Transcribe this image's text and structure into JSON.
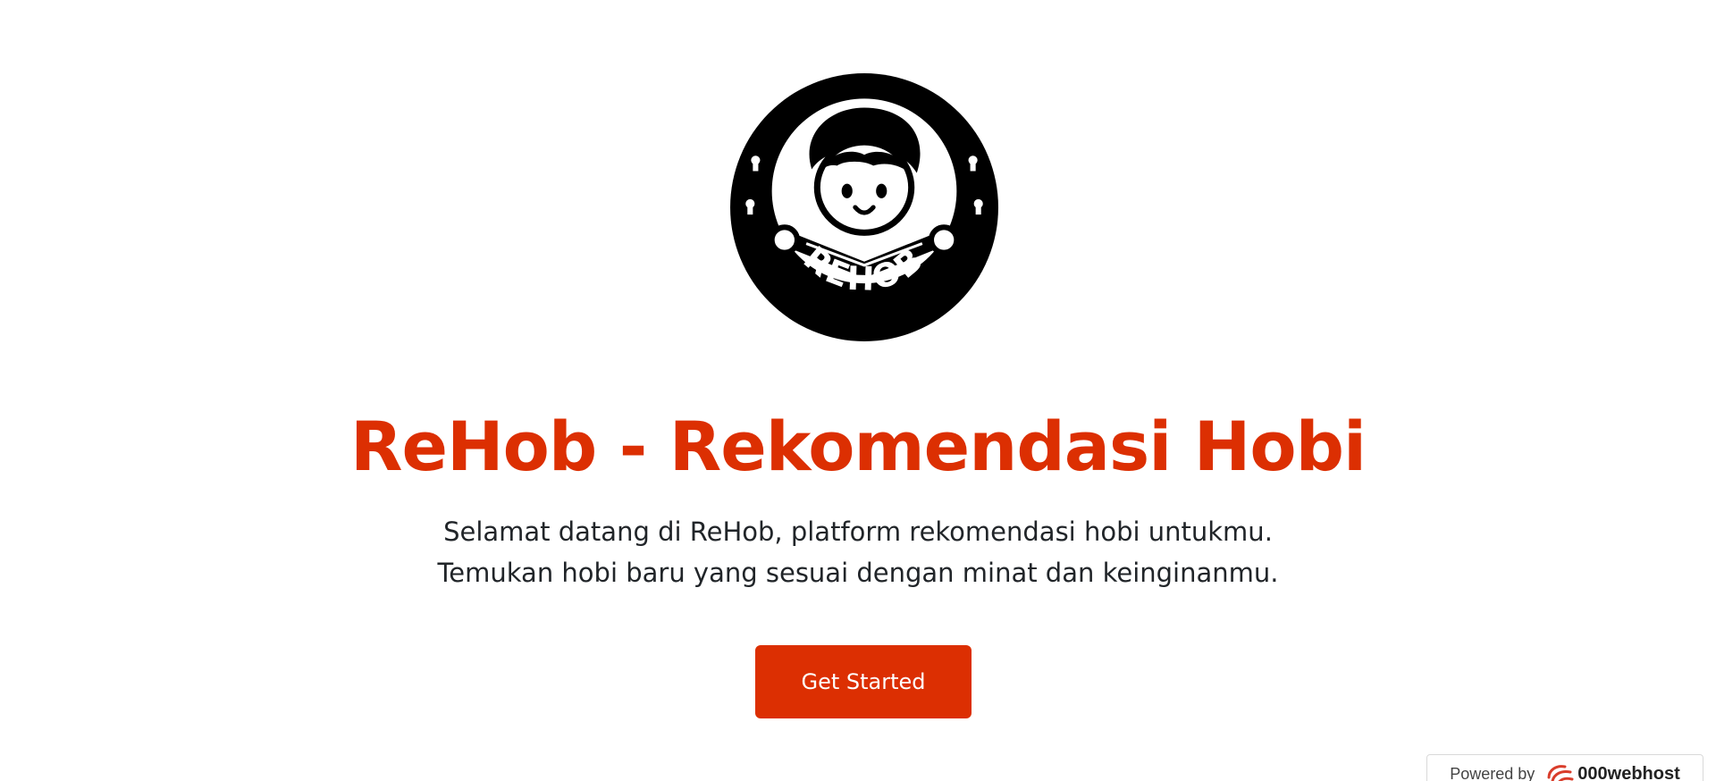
{
  "logo": {
    "text": "REHOB",
    "icon": "child-reading-book-logo",
    "color": "#000000"
  },
  "hero": {
    "title": "ReHob - Rekomendasi Hobi",
    "description": "Selamat datang di ReHob, platform rekomendasi hobi untukmu. Temukan hobi baru yang sesuai dengan minat dan keinginanmu.",
    "cta_label": "Get Started"
  },
  "footer_badge": {
    "powered_by": "Powered by",
    "brand": "000webhost",
    "icon": "000webhost-logo-icon"
  },
  "colors": {
    "accent": "#dc2f02",
    "text": "#212529",
    "background": "#ffffff"
  }
}
